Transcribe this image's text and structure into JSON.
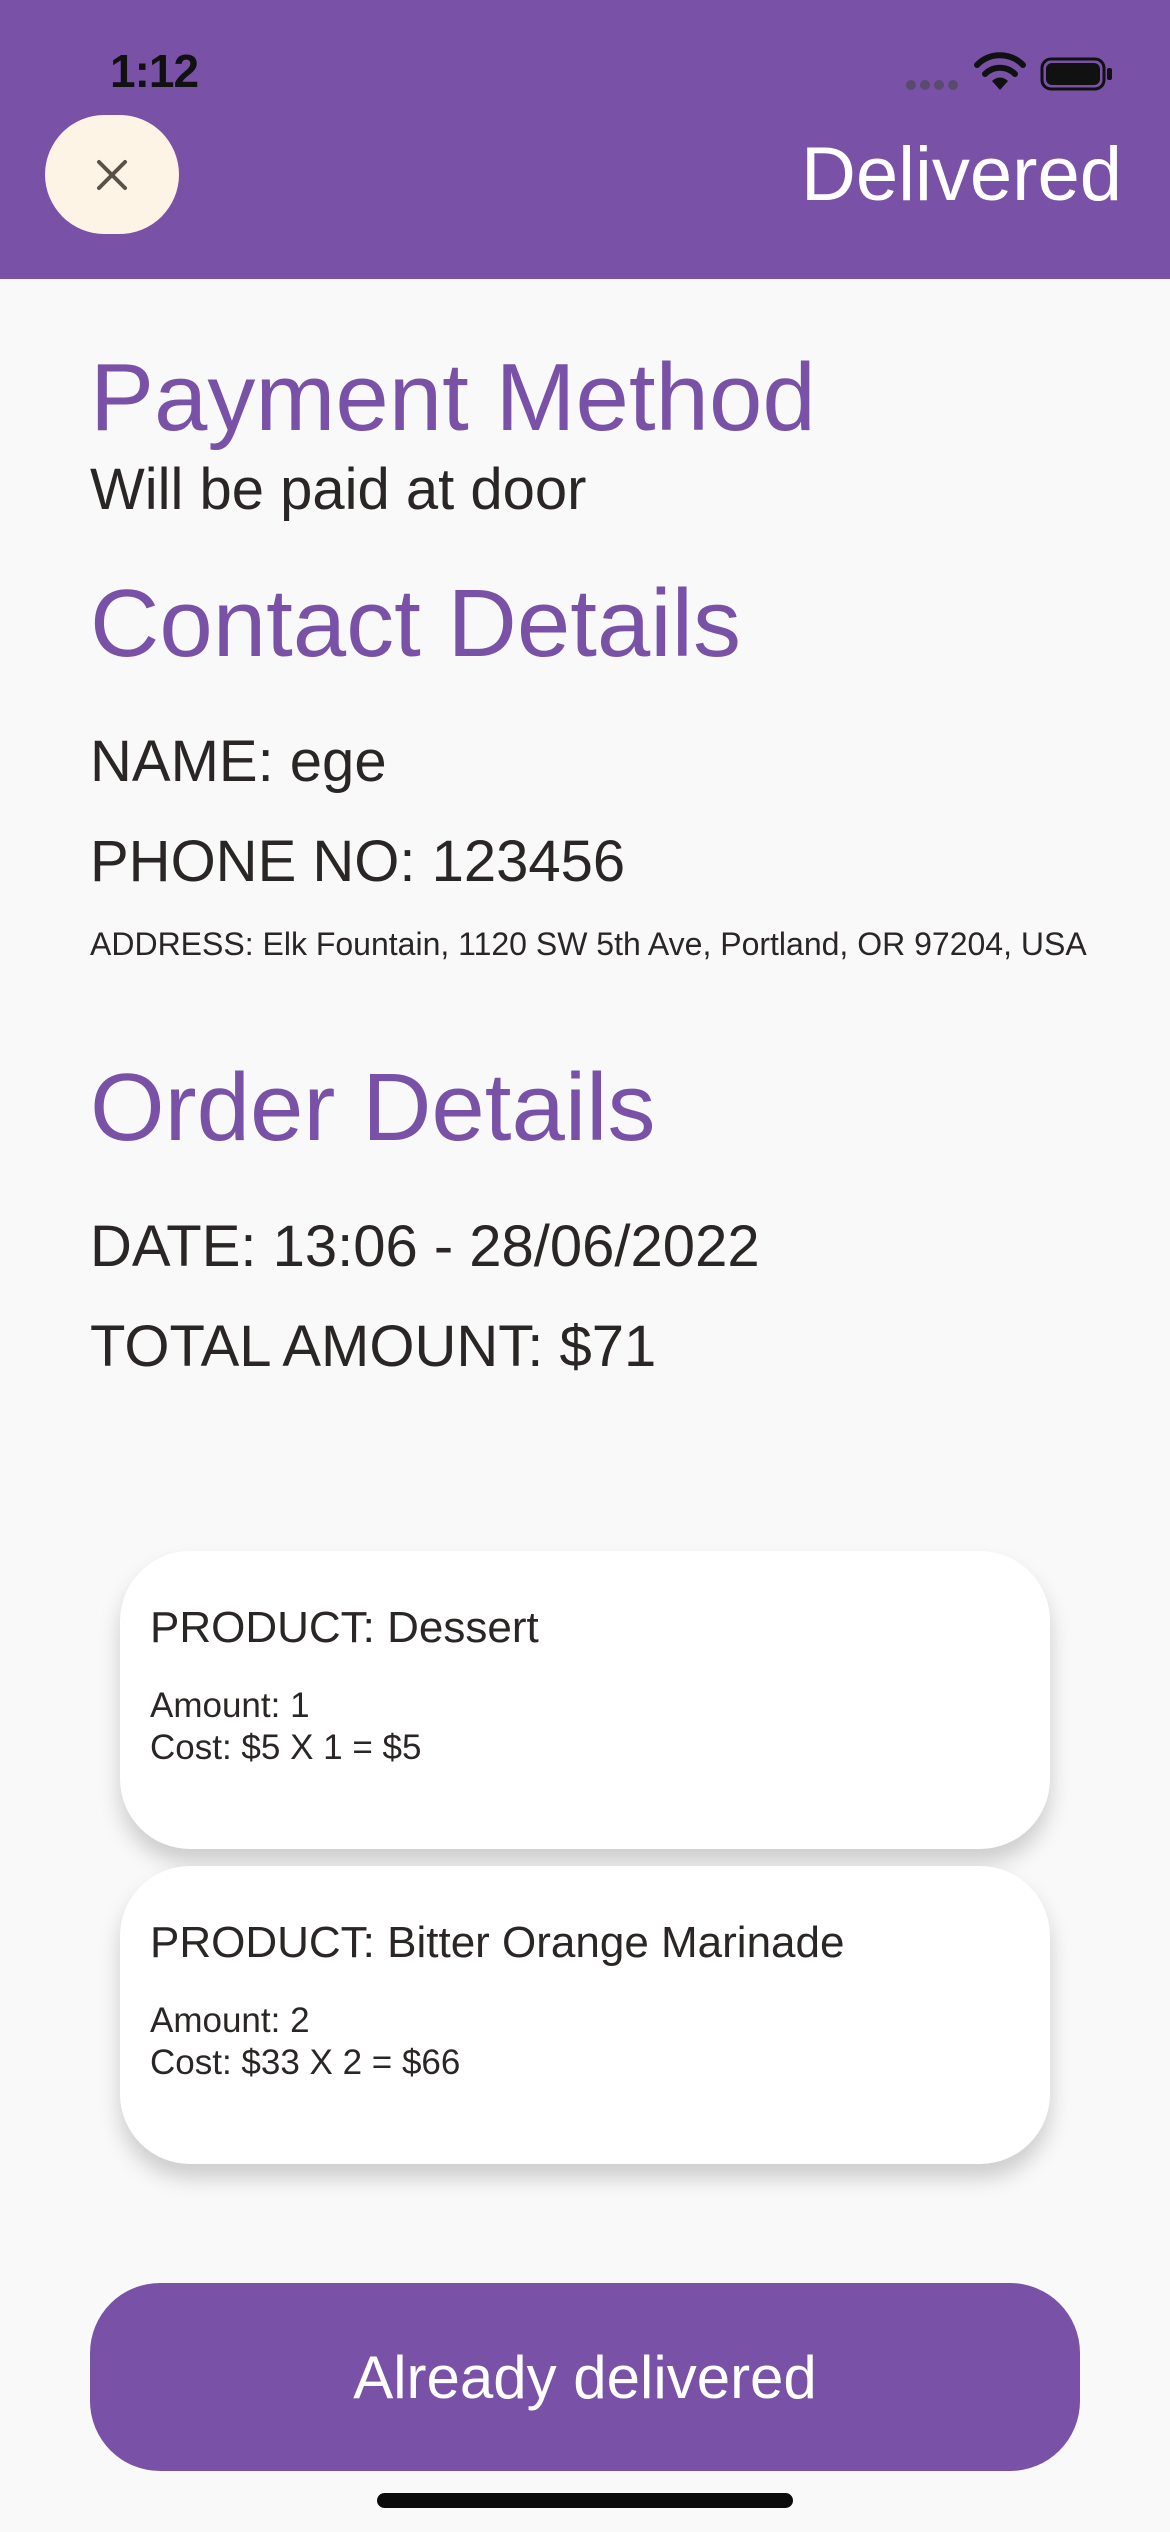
{
  "status_bar": {
    "time": "1:12"
  },
  "header": {
    "close_icon": "close-icon",
    "title": "Delivered"
  },
  "payment": {
    "title": "Payment Method",
    "value": "Will be paid at door"
  },
  "contact": {
    "title": "Contact Details",
    "name": "NAME: ege",
    "phone": "PHONE NO: 123456",
    "address": "ADDRESS: Elk Fountain, 1120 SW 5th Ave, Portland, OR 97204, USA"
  },
  "order": {
    "title": "Order Details",
    "date": "DATE: 13:06 - 28/06/2022",
    "total": "TOTAL AMOUNT: $71",
    "items": [
      {
        "product": "PRODUCT: Dessert",
        "amount": "Amount: 1",
        "cost": "Cost: $5 X 1 = $5"
      },
      {
        "product": "PRODUCT: Bitter Orange Marinade",
        "amount": "Amount: 2",
        "cost": "Cost: $33 X 2 = $66"
      }
    ]
  },
  "action": {
    "label": "Already delivered"
  },
  "colors": {
    "accent": "#7952a8",
    "close_button_bg": "#fdf4e5",
    "background": "#f9f9f9"
  }
}
